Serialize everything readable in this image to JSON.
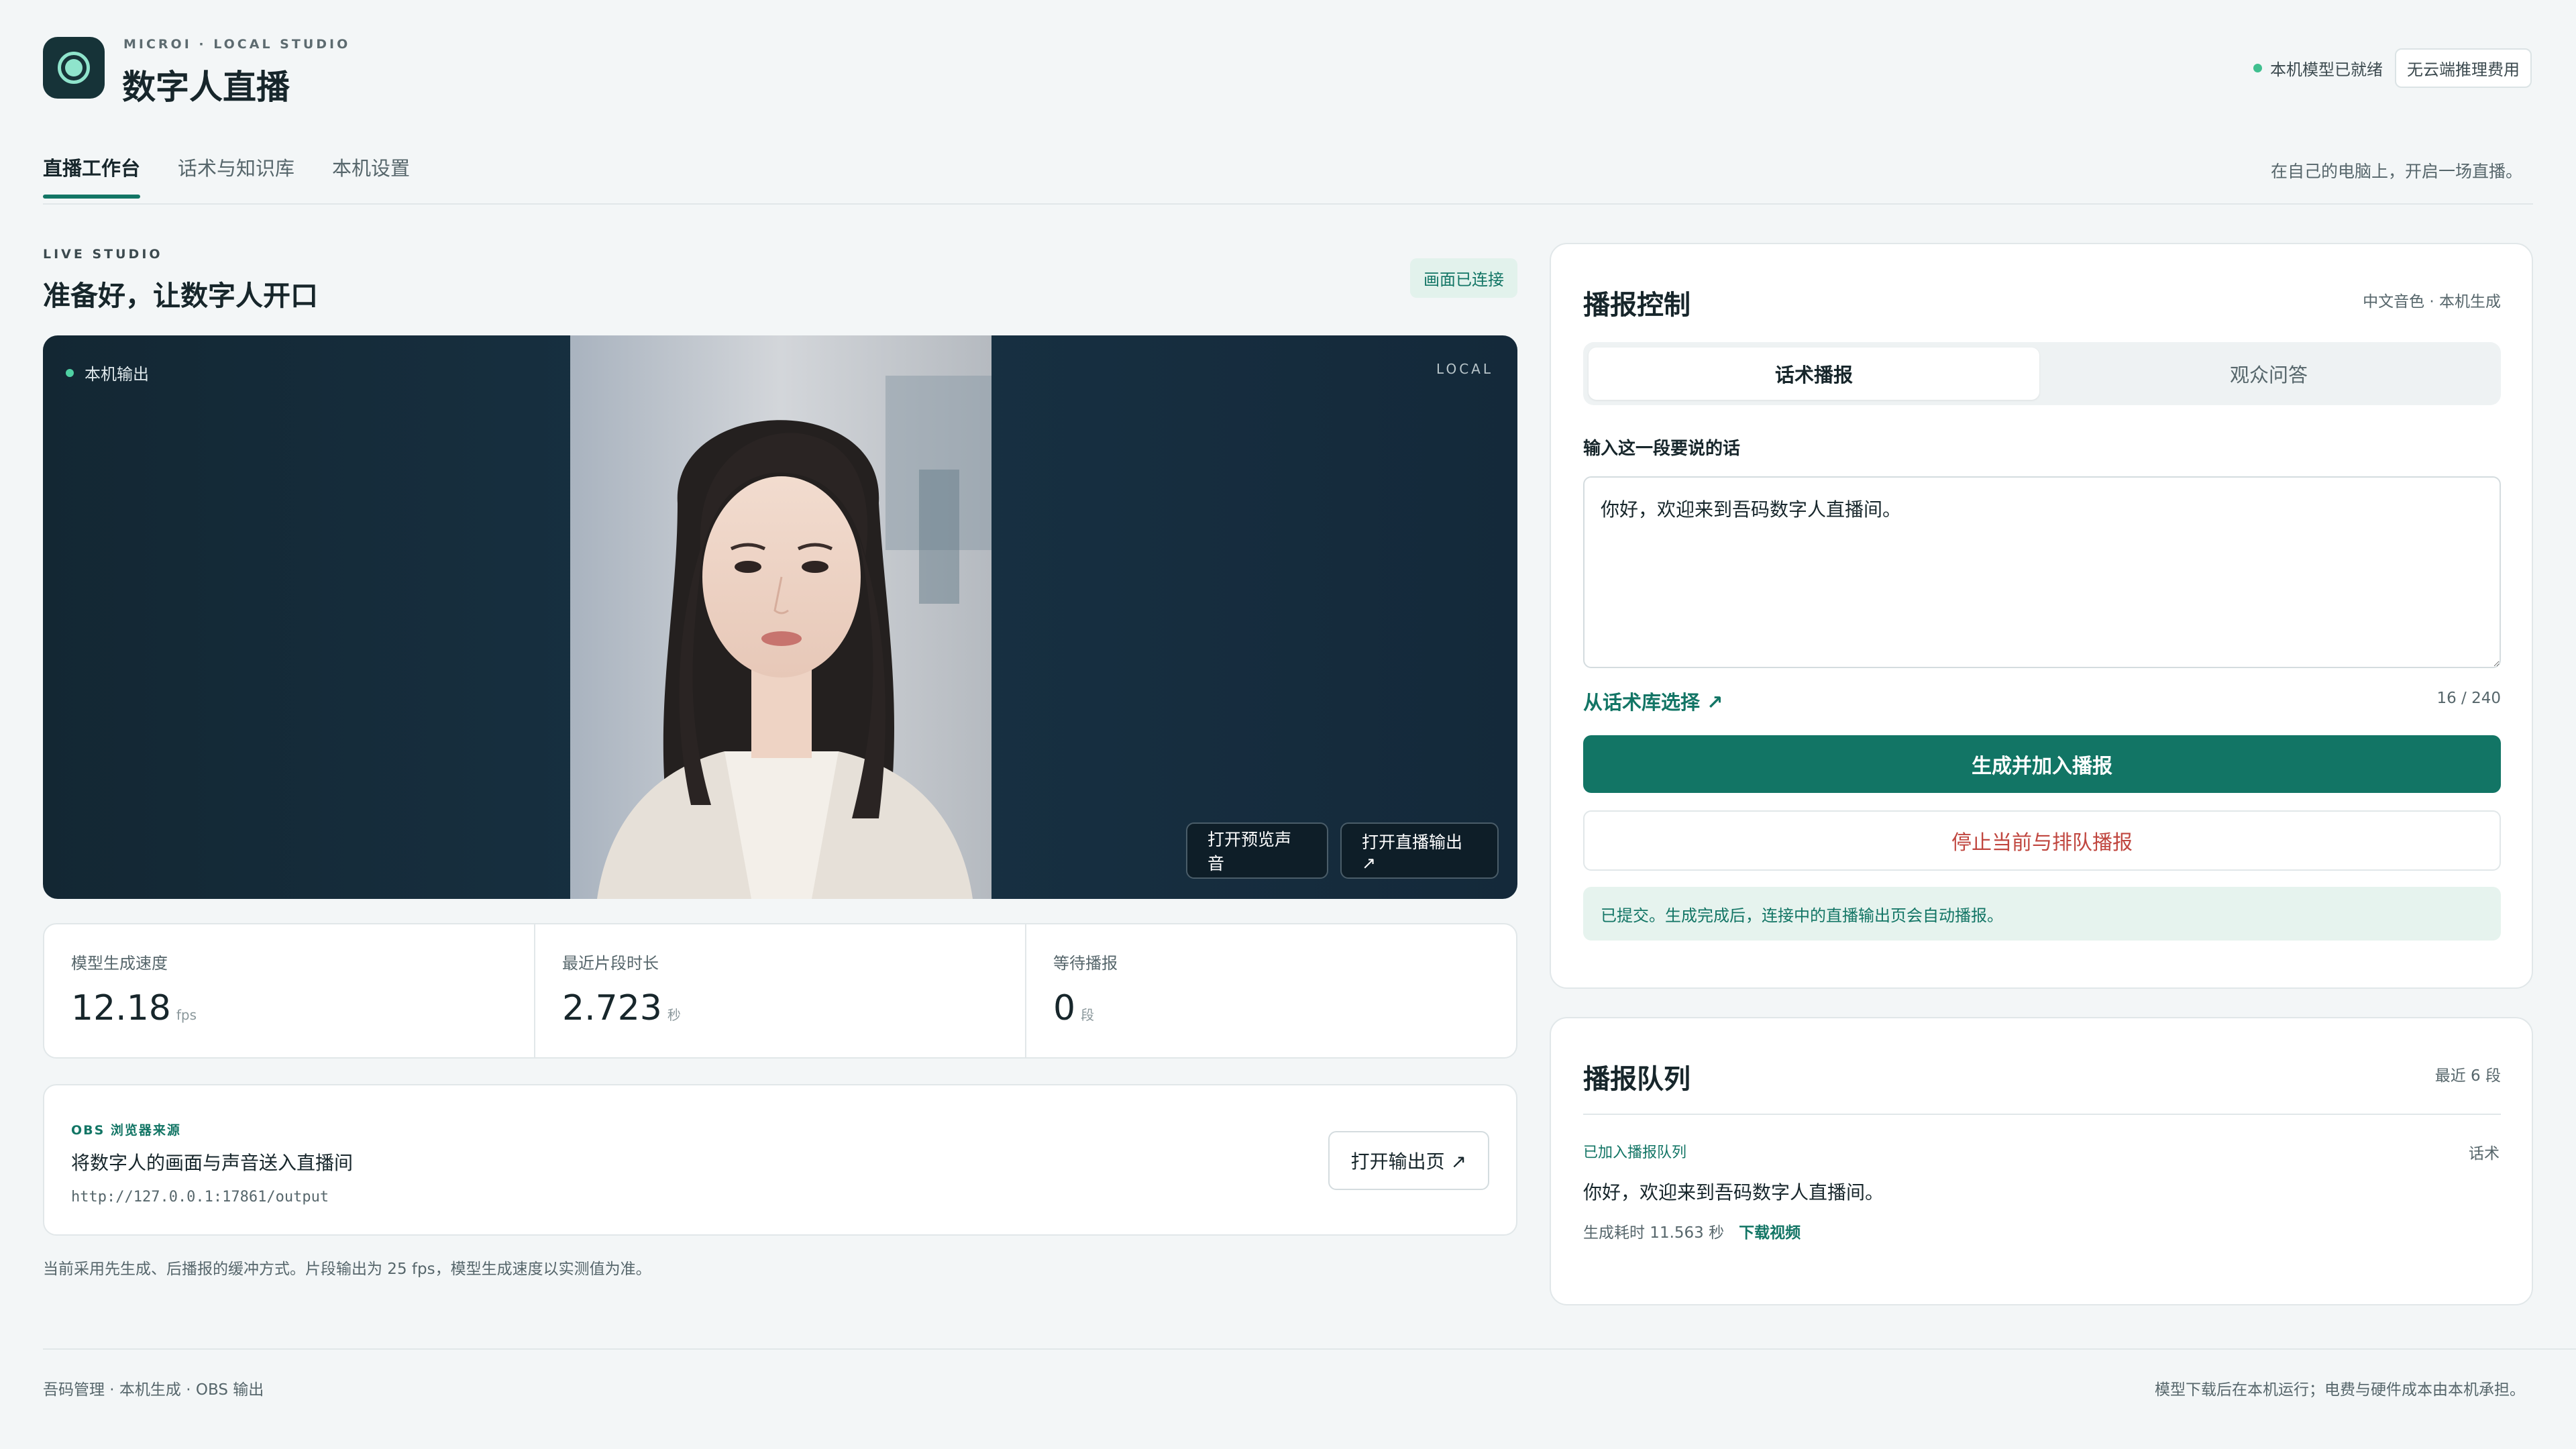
{
  "header": {
    "brand_sub": "MICROI · LOCAL STUDIO",
    "title": "数字人直播",
    "status": "本机模型已就绪",
    "chip": "无云端推理费用",
    "colors": {
      "accent": "#127565",
      "status_dot": "#3fbf8f",
      "danger": "#c0463f"
    }
  },
  "tabs": [
    {
      "label": "直播工作台",
      "active": true
    },
    {
      "label": "话术与知识库",
      "active": false
    },
    {
      "label": "本机设置",
      "active": false
    }
  ],
  "tagline": "在自己的电脑上，开启一场直播。",
  "studio": {
    "eyebrow": "LIVE STUDIO",
    "title": "准备好，让数字人开口",
    "badge": "画面已连接",
    "stage_label": "本机输出",
    "stage_local": "LOCAL",
    "btn_preview": "打开预览声音",
    "btn_output": "打开直播输出 ↗"
  },
  "metrics": [
    {
      "label": "模型生成速度",
      "value": "12.18",
      "unit": "fps"
    },
    {
      "label": "最近片段时长",
      "value": "2.723",
      "unit": "秒"
    },
    {
      "label": "等待播报",
      "value": "0",
      "unit": "段"
    }
  ],
  "obs": {
    "eyebrow": "OBS 浏览器来源",
    "title": "将数字人的画面与声音送入直播间",
    "url": "http://127.0.0.1:17861/output",
    "button": "打开输出页 ↗"
  },
  "note": "当前采用先生成、后播报的缓冲方式。片段输出为 25 fps，模型生成速度以实测值为准。",
  "control": {
    "title": "播报控制",
    "meta": "中文音色 · 本机生成",
    "seg_a": "话术播报",
    "seg_b": "观众问答",
    "field_label": "输入这一段要说的话",
    "text": "你好，欢迎来到吾码数字人直播间。",
    "from_lib": "从话术库选择 ↗",
    "count": "16 / 240",
    "primary": "生成并加入播报",
    "danger": "停止当前与排队播报",
    "info": "已提交。生成完成后，连接中的直播输出页会自动播报。"
  },
  "queue": {
    "title": "播报队列",
    "meta": "最近 6 段",
    "eyebrow": "已加入播报队列",
    "type": "话术",
    "text": "你好，欢迎来到吾码数字人直播间。",
    "time": "生成耗时 11.563 秒",
    "download": "下载视频"
  },
  "footer": {
    "left": "吾码管理 · 本机生成 · OBS 输出",
    "right": "模型下载后在本机运行；电费与硬件成本由本机承担。"
  }
}
